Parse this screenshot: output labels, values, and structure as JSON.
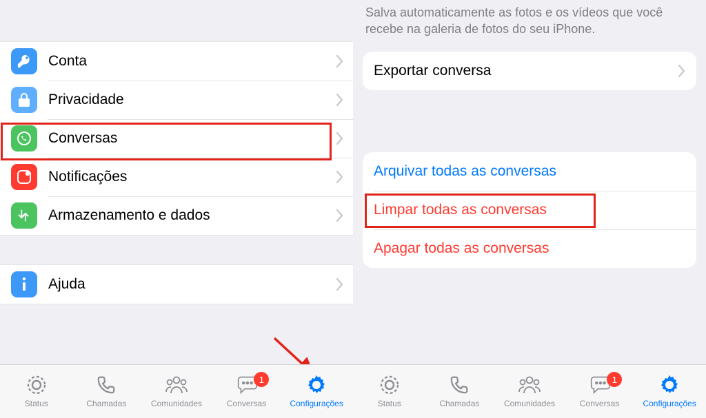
{
  "left": {
    "rows": [
      {
        "id": "account",
        "label": "Conta"
      },
      {
        "id": "privacy",
        "label": "Privacidade"
      },
      {
        "id": "chats",
        "label": "Conversas"
      },
      {
        "id": "notifications",
        "label": "Notificações"
      },
      {
        "id": "storage",
        "label": "Armazenamento e dados"
      }
    ],
    "help": {
      "label": "Ajuda"
    }
  },
  "right": {
    "description": "Salva automaticamente as fotos e os vídeos que você recebe na galeria de fotos do seu iPhone.",
    "export": {
      "label": "Exportar conversa"
    },
    "actions": [
      {
        "id": "archive",
        "label": "Arquivar todas as conversas",
        "style": "link"
      },
      {
        "id": "clear",
        "label": "Limpar todas as conversas",
        "style": "red"
      },
      {
        "id": "delete",
        "label": "Apagar todas as conversas",
        "style": "red"
      }
    ]
  },
  "tabs": {
    "status": {
      "label": "Status"
    },
    "calls": {
      "label": "Chamadas"
    },
    "communities": {
      "label": "Comunidades"
    },
    "chats": {
      "label": "Conversas",
      "badge": "1"
    },
    "settings": {
      "label": "Configurações"
    }
  }
}
